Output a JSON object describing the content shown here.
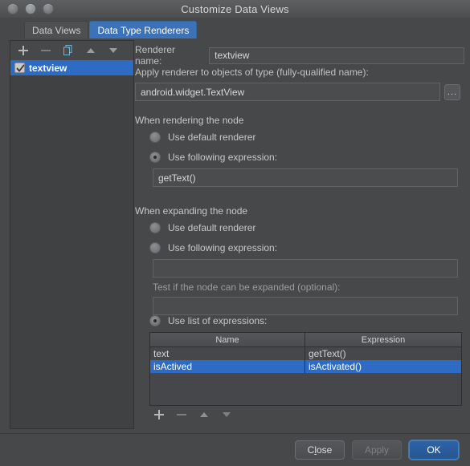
{
  "window": {
    "title": "Customize Data Views",
    "traffic_lights": [
      "close-button",
      "minimize-button",
      "zoom-button"
    ]
  },
  "tabs": [
    {
      "label": "Data Views",
      "active": false
    },
    {
      "label": "Data Type Renderers",
      "active": true
    }
  ],
  "left_panel": {
    "toolbar": [
      {
        "icon": "plus-icon",
        "label": "+",
        "enabled": true
      },
      {
        "icon": "minus-icon",
        "label": "−",
        "enabled": false
      },
      {
        "icon": "copy-icon",
        "label": "Copy",
        "enabled": true
      },
      {
        "icon": "arrow-up-icon",
        "label": "▲",
        "enabled": true
      },
      {
        "icon": "arrow-down-icon",
        "label": "▼",
        "enabled": true
      }
    ],
    "items": [
      {
        "label": "textview",
        "checked": true,
        "selected": true
      }
    ]
  },
  "renderer": {
    "name_label": "Renderer name:",
    "name_value": "textview",
    "apply_label": "Apply renderer to objects of type (fully-qualified name):",
    "type_value": "android.widget.TextView",
    "browse_label": "..."
  },
  "rendering_section": {
    "title": "When rendering the node",
    "options": [
      {
        "label": "Use default renderer",
        "checked": false
      },
      {
        "label": "Use following expression:",
        "checked": true
      }
    ],
    "expression_value": "getText()"
  },
  "expanding_section": {
    "title": "When expanding the node",
    "options": [
      {
        "label": "Use default renderer",
        "checked": false
      },
      {
        "label": "Use following expression:",
        "checked": false
      },
      {
        "label": "Use list of expressions:",
        "checked": true
      }
    ],
    "expression_value": "",
    "test_label": "Test if the node can be expanded (optional):",
    "test_value": ""
  },
  "expressions_table": {
    "columns": [
      "Name",
      "Expression"
    ],
    "rows": [
      {
        "name": "text",
        "expression": "getText()",
        "selected": false
      },
      {
        "name": "isActived",
        "expression": "isActivated()",
        "selected": true
      }
    ],
    "toolbar": [
      {
        "icon": "plus-icon",
        "label": "+",
        "enabled": true
      },
      {
        "icon": "minus-icon",
        "label": "−",
        "enabled": false
      },
      {
        "icon": "arrow-up-icon",
        "label": "▲",
        "enabled": false
      },
      {
        "icon": "arrow-down-icon",
        "label": "▼",
        "enabled": false
      }
    ]
  },
  "footer": {
    "close_pre": "C",
    "close_mnemonic": "l",
    "close_post": "ose",
    "apply_label": "Apply",
    "ok_label": "OK"
  },
  "colors": {
    "window_bg": "#46484a",
    "accent_blue": "#2d6bc4",
    "tab_active": "#3b72b8",
    "panel_bg": "#3f4143",
    "field_bg": "#4a4c4e",
    "text": "#c6c8ca"
  }
}
